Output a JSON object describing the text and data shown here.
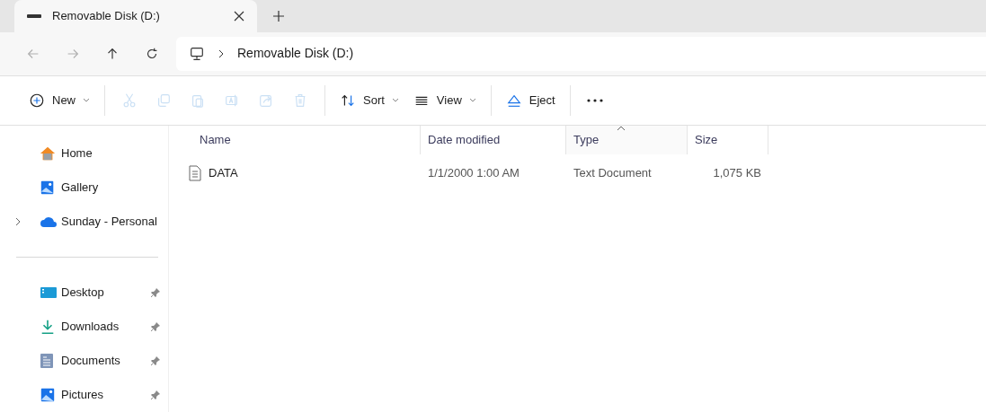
{
  "tabs": [
    {
      "label": "Removable Disk (D:)",
      "selected": true
    }
  ],
  "address": {
    "segments": [
      "Removable Disk (D:)"
    ]
  },
  "nav": {
    "back_disabled": true,
    "forward_disabled": true
  },
  "toolbar": [
    {
      "kind": "new",
      "label": "New",
      "disabled": false
    },
    {
      "kind": "cut",
      "disabled": true
    },
    {
      "kind": "copy",
      "disabled": true
    },
    {
      "kind": "paste",
      "disabled": true
    },
    {
      "kind": "rename",
      "disabled": true
    },
    {
      "kind": "share",
      "disabled": true
    },
    {
      "kind": "delete",
      "disabled": true
    },
    {
      "kind": "sort",
      "label": "Sort",
      "disabled": false
    },
    {
      "kind": "view",
      "label": "View",
      "disabled": false
    },
    {
      "kind": "eject",
      "label": "Eject",
      "disabled": false
    },
    {
      "kind": "more",
      "disabled": false
    }
  ],
  "sidebar": {
    "groups": [
      [
        {
          "label": "Home",
          "expandable": false,
          "pinned": false
        },
        {
          "label": "Gallery",
          "expandable": false,
          "pinned": false
        },
        {
          "label": "Sunday - Personal",
          "expandable": true,
          "pinned": false
        }
      ],
      [
        {
          "label": "Desktop",
          "expandable": false,
          "pinned": true
        },
        {
          "label": "Downloads",
          "expandable": false,
          "pinned": true
        },
        {
          "label": "Documents",
          "expandable": false,
          "pinned": true
        },
        {
          "label": "Pictures",
          "expandable": false,
          "pinned": true
        }
      ]
    ]
  },
  "table": {
    "columns": [
      {
        "label": "Name",
        "sorted": false
      },
      {
        "label": "Date modified",
        "sorted": false
      },
      {
        "label": "Type",
        "sorted": true
      },
      {
        "label": "Size",
        "sorted": false
      }
    ],
    "rows": [
      {
        "name": "DATA",
        "date_modified": "1/1/2000 1:00 AM",
        "type": "Text Document",
        "size": "1,075 KB"
      }
    ]
  }
}
